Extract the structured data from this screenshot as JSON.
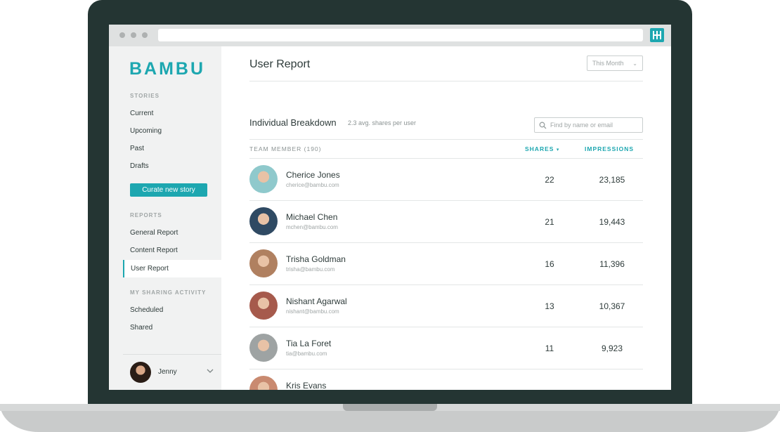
{
  "brand": {
    "logo_text": "BAMBU",
    "accent": "#1da7b0"
  },
  "sidebar": {
    "sections": [
      {
        "label": "STORIES",
        "items": [
          "Current",
          "Upcoming",
          "Past",
          "Drafts"
        ]
      },
      {
        "label": "REPORTS",
        "items": [
          "General Report",
          "Content Report",
          "User Report"
        ]
      },
      {
        "label": "MY SHARING ACTIVITY",
        "items": [
          "Scheduled",
          "Shared"
        ]
      }
    ],
    "curate_button": "Curate new story",
    "active_item": "User Report",
    "user": {
      "name": "Jenny"
    }
  },
  "main": {
    "title": "User Report",
    "period_select": "This Month",
    "breakdown": {
      "title": "Individual Breakdown",
      "subtitle": "2.3 avg. shares per user",
      "search_placeholder": "Find by name or email"
    },
    "table": {
      "columns": {
        "member": "TEAM MEMBER (190)",
        "shares": "SHARES",
        "impressions": "IMPRESSIONS"
      },
      "rows": [
        {
          "name": "Cherice Jones",
          "email": "cherice@bambu.com",
          "shares": "22",
          "impressions": "23,185",
          "avatar_bg": "#8fc9cc"
        },
        {
          "name": "Michael Chen",
          "email": "mchen@bambu.com",
          "shares": "21",
          "impressions": "19,443",
          "avatar_bg": "#2f4a63"
        },
        {
          "name": "Trisha Goldman",
          "email": "trisha@bambu.com",
          "shares": "16",
          "impressions": "11,396",
          "avatar_bg": "#b08060"
        },
        {
          "name": "Nishant Agarwal",
          "email": "nishant@bambu.com",
          "shares": "13",
          "impressions": "10,367",
          "avatar_bg": "#a65a4c"
        },
        {
          "name": "Tia La Foret",
          "email": "tia@bambu.com",
          "shares": "11",
          "impressions": "9,923",
          "avatar_bg": "#9ea3a3"
        },
        {
          "name": "Kris Evans",
          "email": "",
          "shares": "",
          "impressions": "",
          "avatar_bg": "#c98a70"
        }
      ]
    }
  }
}
